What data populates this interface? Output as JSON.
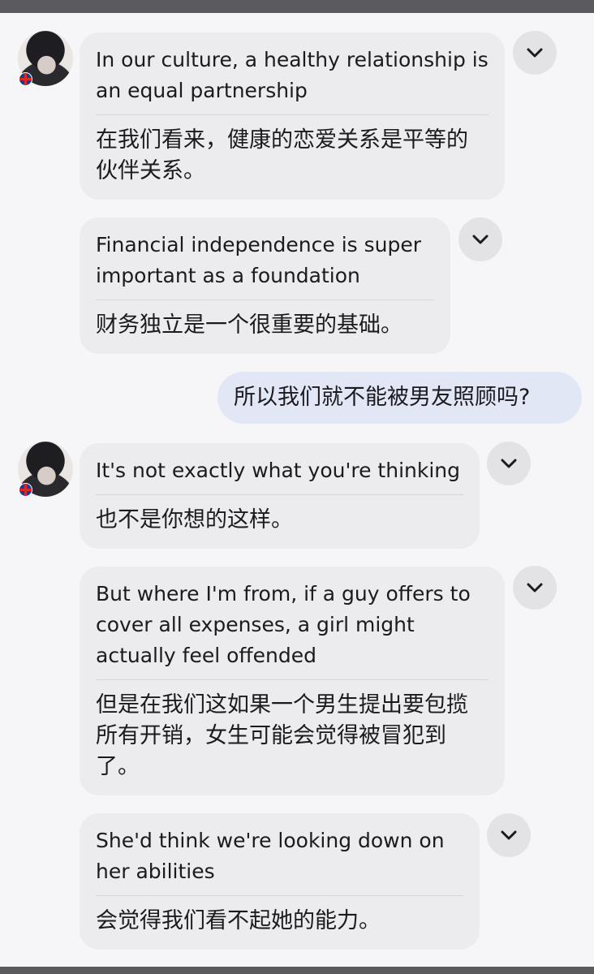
{
  "messages": [
    {
      "en": "In our culture, a healthy relationship is an equal partnership",
      "zh": "在我们看来，健康的恋爱关系是平等的伙伴关系。"
    },
    {
      "en": "Financial independence is super important as a foundation",
      "zh": "财务独立是一个很重要的基础。"
    },
    {
      "en": "It's not exactly what you're thinking",
      "zh": "也不是你想的这样。"
    },
    {
      "en": "But where I'm from, if a guy offers to cover all expenses, a girl might actually feel offended",
      "zh": "但是在我们这如果一个男生提出要包揽所有开销，女生可能会觉得被冒犯到了。"
    },
    {
      "en": "She'd think we're looking down on her abilities",
      "zh": "会觉得我们看不起她的能力。"
    }
  ],
  "sent_message": "所以我们就不能被男友照顾吗?",
  "icons": {
    "avatar_flag": "uk-flag-icon",
    "expand": "chevron-down-icon"
  },
  "colors": {
    "received_bubble": "#ececef",
    "sent_bubble": "#e2e7f6",
    "background": "#f6f6f8"
  }
}
